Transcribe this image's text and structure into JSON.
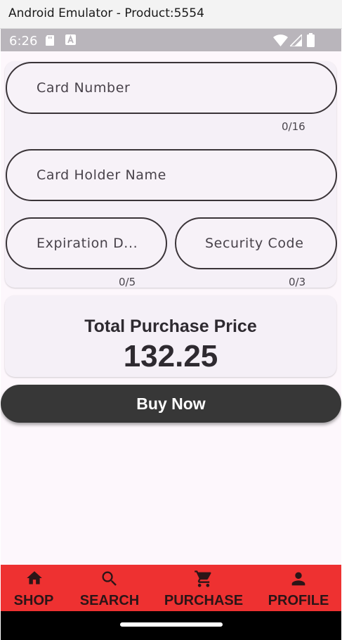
{
  "window": {
    "title": "Android Emulator - Product:5554"
  },
  "status_bar": {
    "time": "6:26"
  },
  "form": {
    "card_number": {
      "placeholder": "Card Number",
      "value": "",
      "counter": "0/16"
    },
    "card_holder": {
      "placeholder": "Card Holder Name",
      "value": ""
    },
    "expiration": {
      "placeholder": "Expiration D...",
      "value": "",
      "counter": "0/5"
    },
    "security": {
      "placeholder": "Security Code",
      "value": "",
      "counter": "0/3"
    }
  },
  "total": {
    "label": "Total Purchase Price",
    "value": "132.25"
  },
  "buy_button": {
    "label": "Buy Now"
  },
  "bottom_nav": {
    "items": [
      {
        "label": "SHOP",
        "icon": "home-icon"
      },
      {
        "label": "SEARCH",
        "icon": "search-icon"
      },
      {
        "label": "PURCHASE",
        "icon": "cart-icon"
      },
      {
        "label": "PROFILE",
        "icon": "person-icon"
      }
    ]
  },
  "colors": {
    "nav_background": "#ee3131",
    "button_background": "#373737",
    "screen_background": "#fdf7fc"
  }
}
